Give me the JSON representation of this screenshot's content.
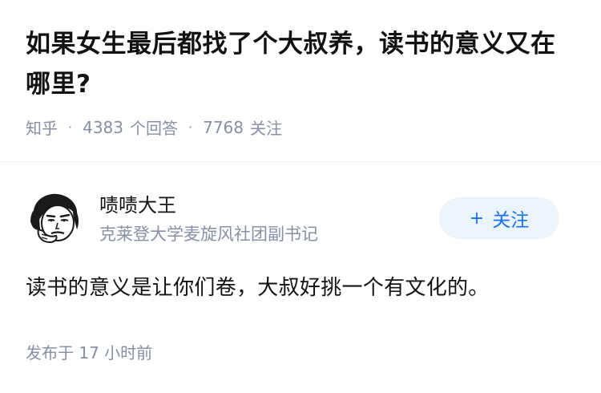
{
  "question": {
    "title": "如果女生最后都找了个大叔养，读书的意义又在哪里?",
    "source": "知乎",
    "answer_count": "4383",
    "answer_label": "个回答",
    "follower_count": "7768",
    "follower_label": "关注"
  },
  "answer": {
    "author": {
      "name": "啧啧大王",
      "bio": "克莱登大学麦旋风社团副书记",
      "avatar_icon": "meme-face-avatar-icon"
    },
    "follow_button": {
      "icon": "+",
      "label": "关注",
      "text_color": "#1772f6",
      "bg_color": "#ebf3fb"
    },
    "content": "读书的意义是让你们卷，大叔好挑一个有文化的。",
    "publish_label": "发布于",
    "publish_time": "17 小时前"
  }
}
